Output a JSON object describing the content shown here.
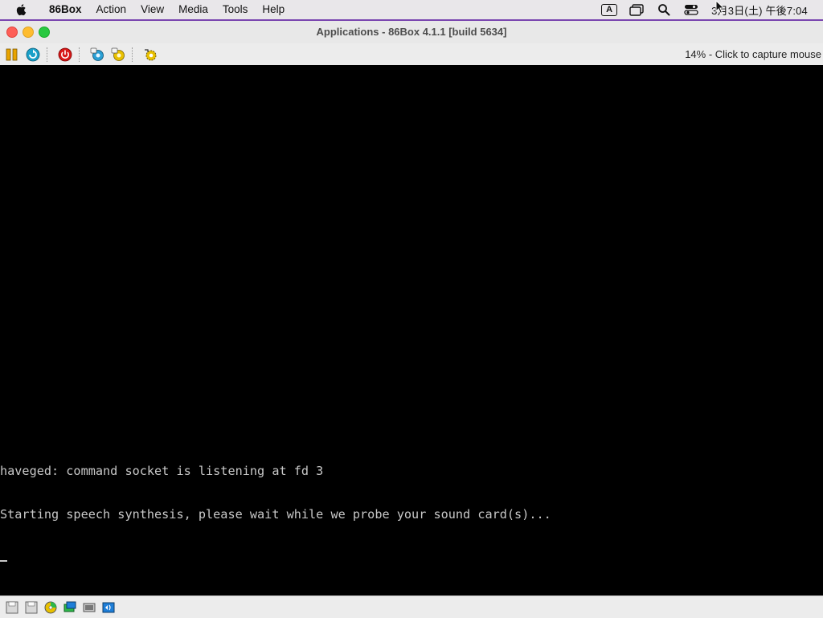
{
  "menubar": {
    "apple_icon": "apple-logo-icon",
    "items": [
      "86Box",
      "Action",
      "View",
      "Media",
      "Tools",
      "Help"
    ],
    "input_source": "A",
    "clock": "3月3日(土) 午後7:04"
  },
  "window": {
    "title": "Applications - 86Box 4.1.1 [build 5634]",
    "status_message": "14% - Click to capture mouse"
  },
  "toolbar": {
    "buttons": [
      "pause-icon",
      "reset-icon",
      "power-icon",
      "ctrl-alt-del-icon",
      "ctrl-alt-esc-icon",
      "settings-icon"
    ]
  },
  "console": {
    "lines": [
      "haveged: command socket is listening at fd 3",
      "Starting speech synthesis, please wait while we probe your sound card(s)..."
    ]
  },
  "statusbar": {
    "icons": [
      "floppy-drive-1-icon",
      "floppy-drive-2-icon",
      "cdrom-icon",
      "hard-disk-icon",
      "network-icon",
      "sound-icon"
    ]
  },
  "colors": {
    "accent_border": "#7a46b0",
    "screen_background": "#000000",
    "console_text": "#c8c8c8"
  }
}
